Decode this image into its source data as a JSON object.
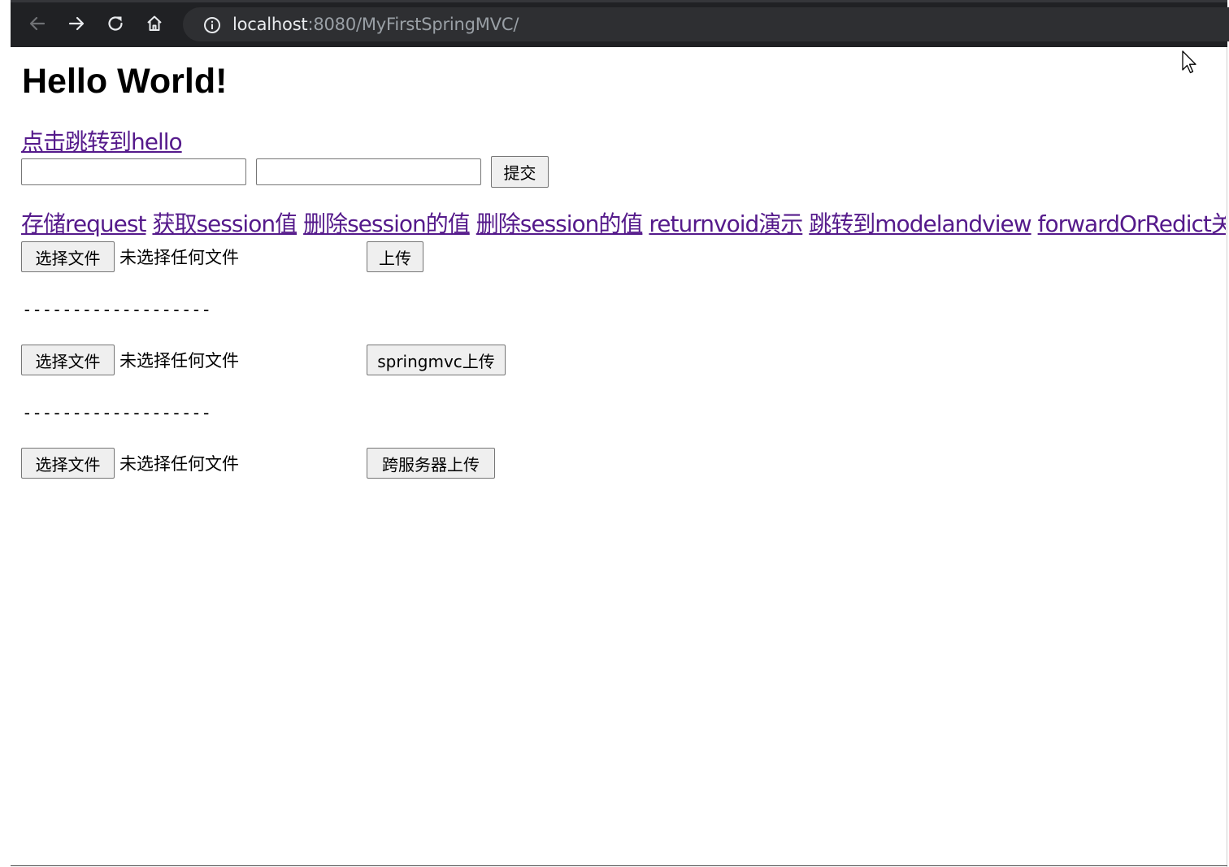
{
  "browser": {
    "url_host": "localhost",
    "url_rest": ":8080/MyFirstSpringMVC/"
  },
  "page": {
    "heading": "Hello World!",
    "hello_link": "点击跳转到hello",
    "submit_label": "提交",
    "links": [
      "存储request",
      "获取session值",
      "删除session的值",
      "删除session的值",
      "returnvoid演示",
      "跳转到modelandview",
      "forwardOrRedict关键字"
    ],
    "uploads": [
      {
        "choose_label": "选择文件",
        "status": "未选择任何文件",
        "submit_label": "上传"
      },
      {
        "choose_label": "选择文件",
        "status": "未选择任何文件",
        "submit_label": "springmvc上传"
      },
      {
        "choose_label": "选择文件",
        "status": "未选择任何文件",
        "submit_label": "跨服务器上传"
      }
    ],
    "separator": "-------------------"
  }
}
